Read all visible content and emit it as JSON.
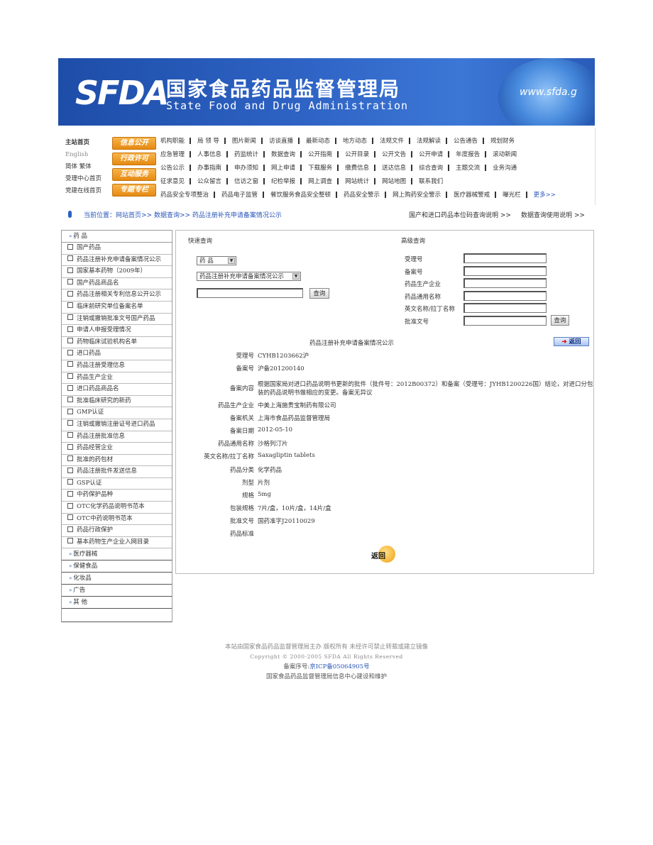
{
  "banner": {
    "logo": "SFDA",
    "title_cn": "国家食品药品监督管理局",
    "title_en": "State Food and Drug Administration",
    "url": "www.sfda.g"
  },
  "nav": {
    "left_links": [
      "主站首页",
      "English",
      "简体 繁体",
      "受理中心首页",
      "党建在线首页"
    ],
    "buttons": [
      "信息公开",
      "行政许可",
      "互动服务",
      "专题专栏"
    ],
    "rows": [
      [
        "机构职能",
        "局 领 导",
        "图片新闻",
        "访谈直播",
        "最新动态",
        "地方动态",
        "法规文件",
        "法规解读",
        "公告通告",
        "规划财务"
      ],
      [
        "应急管理",
        "人事信息",
        "药监统计",
        "数据查询",
        "公开指南",
        "公开目录",
        "公开文告",
        "公开申请",
        "年度报告",
        "滚动新闻"
      ],
      [
        "公告公示",
        "办事指南",
        "申办须知",
        "网上申请",
        "下载服务",
        "缴费信息",
        "送达信息",
        "综合查询",
        "主题交流",
        "业务沟通"
      ],
      [
        "征求意见",
        "公众留言",
        "信访之窗",
        "纪检举报",
        "网上调查",
        "网站统计",
        "网站地图",
        "联系我们"
      ],
      [
        "药品安全专项整治",
        "药品电子监管",
        "餐饮服务食品安全整顿",
        "药品安全警示",
        "网上购药安全警示",
        "医疗器械警戒",
        "曝光栏"
      ]
    ],
    "more": "更多>>"
  },
  "breadcrumb": {
    "location": "当前位置：网站首页>> 数据查询>> 药品注册补充申请备案情况公示",
    "link1": "国产和进口药品本位码查询说明 >>",
    "link2": "数据查询使用说明 >>"
  },
  "menu": {
    "top_category": "药 品",
    "items": [
      "国产药品",
      "药品注册补充申请备案情况公示",
      "国家基本药物（2009年）",
      "国产药品商品名",
      "药品注册相关专利信息公开公示",
      "临床前研究单位备案名单",
      "注销或撤销批准文号国产药品",
      "申请人申报受理情况",
      "药物临床试验机构名单",
      "进口药品",
      "药品注册受理信息",
      "药品生产企业",
      "进口药品商品名",
      "批准临床研究的新药",
      "GMP认证",
      "注销或撤销注册证号进口药品",
      "药品注册批准信息",
      "药品经营企业",
      "批准的药包材",
      "药品注册批件发送信息",
      "GSP认证",
      "中药保护品种",
      "OTC化学药品说明书范本",
      "OTC中药说明书范本",
      "药品行政保护",
      "基本药物生产企业入网目录"
    ],
    "categories": [
      "医疗器械",
      "保健食品",
      "化妆品",
      "广告",
      "其 他"
    ]
  },
  "quick_query": {
    "title": "快速查询",
    "select1": "药 品",
    "select2": "药品注册补充申请备案情况公示",
    "button": "查询"
  },
  "advanced_query": {
    "title": "高级查询",
    "labels": [
      "受理号",
      "备案号",
      "药品生产企业",
      "药品通用名称",
      "英文名称/拉丁名称",
      "批准文号"
    ],
    "button": "查询"
  },
  "detail": {
    "title": "药品注册补充申请备案情况公示",
    "back_label": "返回",
    "fields": [
      {
        "k": "受理号",
        "v": "CYHB1203662沪"
      },
      {
        "k": "备案号",
        "v": "沪备201200140"
      },
      {
        "k": "备案内容",
        "v": "根据国家局对进口药品说明书更新的批件（批件号：2012B00372）和备案（受理号：JYHB1200226国）结论，对进口分包"
      },
      {
        "k": "",
        "v": "装的药品说明书做相应的变更。备案无异议"
      },
      {
        "k": "药品生产企业",
        "v": "中美上海施贵宝制药有限公司"
      },
      {
        "k": "备案机关",
        "v": "上海市食品药品监督管理局"
      },
      {
        "k": "备案日期",
        "v": "2012-05-10"
      },
      {
        "k": "药品通用名称",
        "v": "沙格列汀片"
      },
      {
        "k": "英文名称/拉丁名称",
        "v": "Saxagliptin tablets"
      },
      {
        "k": "药品分类",
        "v": "化学药品"
      },
      {
        "k": "剂型",
        "v": "片剂"
      },
      {
        "k": "规格",
        "v": "5mg"
      },
      {
        "k": "包装规格",
        "v": "7片/盒，10片/盒，14片/盒"
      },
      {
        "k": "批准文号",
        "v": "国药准字J20110029"
      },
      {
        "k": "药品标准",
        "v": ""
      }
    ],
    "bottom_back": "返回"
  },
  "footer": {
    "line1": "本站由国家食品药品监督管理局主办 版权所有 未经许可禁止转载或建立镜像",
    "line2": "Copyright © 2000-2005 SFDA All Rights Reserved",
    "line3_prefix": "备案序号:",
    "line3_link": "京ICP备05064905号",
    "line4": "国家食品药品监督管理局信息中心建设和维护"
  }
}
